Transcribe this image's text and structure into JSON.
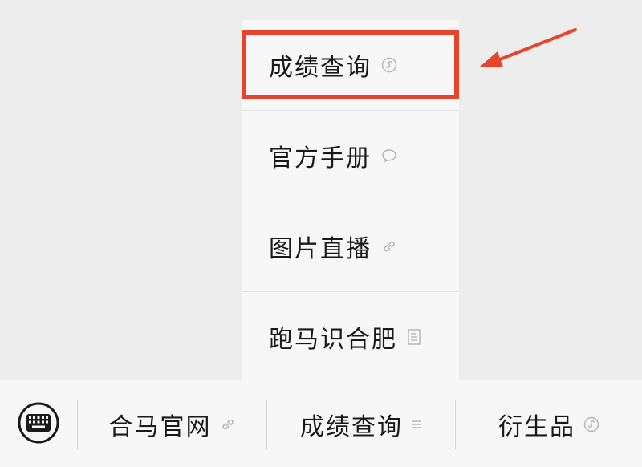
{
  "popup": {
    "items": [
      {
        "label": "成绩查询",
        "icon": "mini-program-icon"
      },
      {
        "label": "官方手册",
        "icon": "chat-bubble-icon"
      },
      {
        "label": "图片直播",
        "icon": "link-icon"
      },
      {
        "label": "跑马识合肥",
        "icon": "document-icon"
      }
    ]
  },
  "menubar": {
    "keyboard_icon": "keyboard-icon",
    "items": [
      {
        "label": "合马官网",
        "icon": "link-icon"
      },
      {
        "label": "成绩查询",
        "icon": "list-icon"
      },
      {
        "label": "衍生品",
        "icon": "mini-program-icon"
      }
    ]
  },
  "colors": {
    "highlight": "#e8432b",
    "background": "#ededed",
    "menu_bg": "#f7f7f7"
  }
}
